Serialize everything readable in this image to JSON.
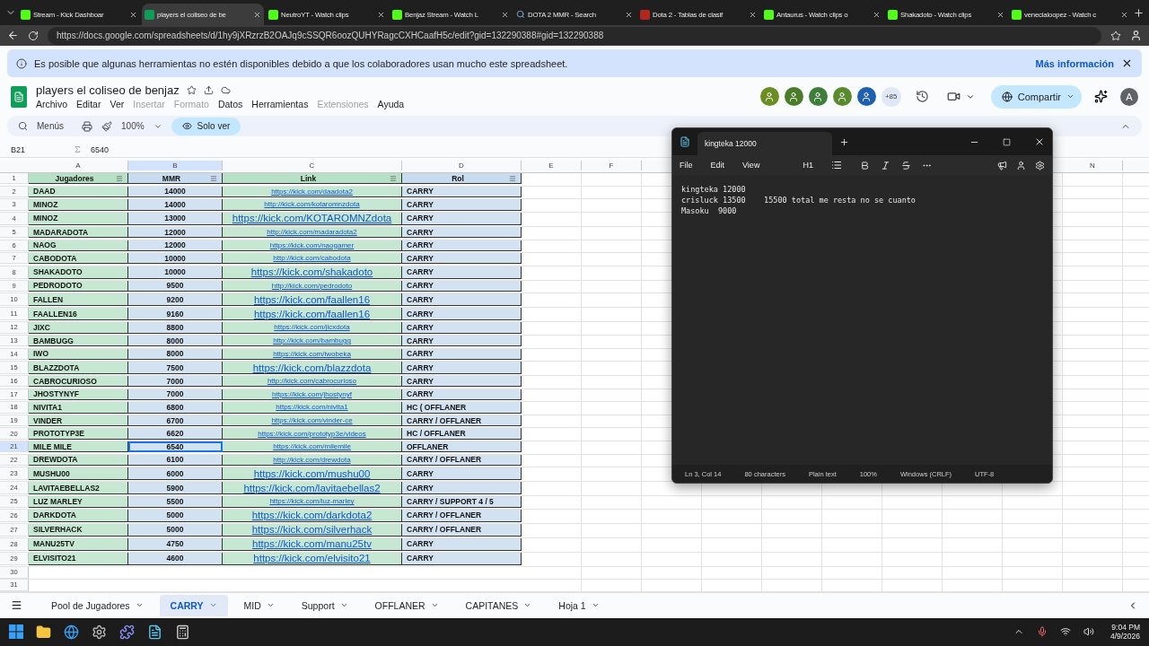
{
  "browser": {
    "tabs": [
      {
        "title": "Stream - Kick Dashboar",
        "kind": "kick",
        "selected": false
      },
      {
        "title": "players el coliseo de be",
        "kind": "sheets",
        "selected": true
      },
      {
        "title": "NeutroYT - Watch clips",
        "kind": "kick",
        "selected": false
      },
      {
        "title": "Benjaz Stream - Watch L",
        "kind": "kick",
        "selected": false
      },
      {
        "title": "DOTA 2 MMR - Search",
        "kind": "search",
        "selected": false
      },
      {
        "title": "Dota 2 - Tablas de clasif",
        "kind": "dota",
        "selected": false
      },
      {
        "title": "Antaurus - Watch clips o",
        "kind": "kick",
        "selected": false
      },
      {
        "title": "Shakadoto - Watch clips",
        "kind": "kick",
        "selected": false
      },
      {
        "title": "venecialoopez - Watch c",
        "kind": "kick",
        "selected": false
      }
    ],
    "url": "https://docs.google.com/spreadsheets/d/1hy9jXRzrzB2OAJq9cSSQR6oozQUHYRagcCXHCaafH5c/edit?gid=132290388#gid=132290388"
  },
  "banner": {
    "text": "Es posible que algunas herramientas no estén disponibles debido a que los colaboradores usan mucho este spreadsheet.",
    "link": "Más información"
  },
  "doc": {
    "title": "players el coliseo de benjaz",
    "menus": [
      {
        "label": "Archivo",
        "disabled": false
      },
      {
        "label": "Editar",
        "disabled": false
      },
      {
        "label": "Ver",
        "disabled": false
      },
      {
        "label": "Insertar",
        "disabled": true
      },
      {
        "label": "Formato",
        "disabled": true
      },
      {
        "label": "Datos",
        "disabled": false
      },
      {
        "label": "Herramientas",
        "disabled": false
      },
      {
        "label": "Extensiones",
        "disabled": true
      },
      {
        "label": "Ayuda",
        "disabled": false
      }
    ],
    "avatars": [
      {
        "color": "#6b8e23"
      },
      {
        "color": "#4a7c2a"
      },
      {
        "color": "#3f7d3a"
      },
      {
        "color": "#5a8a2e"
      },
      {
        "color": "#1f5fb0"
      }
    ],
    "more_count": "+85",
    "share": "Compartir",
    "account": "A"
  },
  "toolbar": {
    "menus": "Menús",
    "zoom": "100%",
    "mode": "Solo ver"
  },
  "formula": {
    "cell": "B21",
    "value": "6540"
  },
  "grid": {
    "columns": [
      "A",
      "B",
      "C",
      "D",
      "E",
      "F"
    ],
    "far_column": "N",
    "header": {
      "number": "1",
      "cells": [
        "Jugadores",
        "MMR",
        "Link",
        "Rol"
      ]
    },
    "rows": [
      {
        "number": "2",
        "player": "DAAD",
        "mmr": "14000",
        "link": "https://kick.com/daadota2",
        "kind": "small",
        "rol": "CARRY",
        "selected": false
      },
      {
        "number": "3",
        "player": "MINOZ",
        "mmr": "14000",
        "link": "http://kick.com/kotaromnzdota",
        "kind": "small",
        "rol": "CARRY",
        "selected": false
      },
      {
        "number": "4",
        "player": "MINOZ",
        "mmr": "13000",
        "link": "https://kick.com/KOTAROMNZdota",
        "kind": "large",
        "rol": "CARRY",
        "selected": false
      },
      {
        "number": "5",
        "player": "MADARADOTA",
        "mmr": "12000",
        "link": "http://kick.com/madaradota2",
        "kind": "small",
        "rol": "CARRY",
        "selected": false
      },
      {
        "number": "6",
        "player": "NAOG",
        "mmr": "12000",
        "link": "https://kick.com/naogamer",
        "kind": "small",
        "rol": "CARRY",
        "selected": false
      },
      {
        "number": "7",
        "player": "CABODOTA",
        "mmr": "10000",
        "link": "http://kick.com/cabodota",
        "kind": "small",
        "rol": "CARRY",
        "selected": false
      },
      {
        "number": "8",
        "player": "SHAKADOTO",
        "mmr": "10000",
        "link": "https://kick.com/shakadoto",
        "kind": "large",
        "rol": "CARRY",
        "selected": false
      },
      {
        "number": "9",
        "player": "PEDRODOTO",
        "mmr": "9500",
        "link": "http://kick.com/pedrodoto",
        "kind": "small",
        "rol": "CARRY",
        "selected": false
      },
      {
        "number": "10",
        "player": "FALLEN",
        "mmr": "9200",
        "link": "https://kick.com/faallen16",
        "kind": "large",
        "rol": "CARRY",
        "selected": false
      },
      {
        "number": "11",
        "player": "FAALLEN16",
        "mmr": "9160",
        "link": "https://kick.com/faallen16",
        "kind": "large",
        "rol": "CARRY",
        "selected": false
      },
      {
        "number": "12",
        "player": "JIXC",
        "mmr": "8800",
        "link": "https://kick.com/jicxdota",
        "kind": "small",
        "rol": "CARRY",
        "selected": false
      },
      {
        "number": "13",
        "player": "BAMBUGG",
        "mmr": "8000",
        "link": "http://kick.com/bambugg",
        "kind": "small",
        "rol": "CARRY",
        "selected": false
      },
      {
        "number": "14",
        "player": "IWO",
        "mmr": "8000",
        "link": "https://kick.com/iwobeka",
        "kind": "small",
        "rol": "CARRY",
        "selected": false
      },
      {
        "number": "15",
        "player": "BLAZZDOTA",
        "mmr": "7500",
        "link": "https://kick.com/blazzdota",
        "kind": "large",
        "rol": "CARRY",
        "selected": false
      },
      {
        "number": "16",
        "player": "CABROCURIOSO",
        "mmr": "7000",
        "link": "http://kick.com/cabrocurioso",
        "kind": "small",
        "rol": "CARRY",
        "selected": false
      },
      {
        "number": "17",
        "player": "JHOSTYNYF",
        "mmr": "7000",
        "link": "https://kick.com/jhostynyf",
        "kind": "small",
        "rol": "CARRY",
        "selected": false
      },
      {
        "number": "18",
        "player": "NIVITA1",
        "mmr": "6800",
        "link": "https://kick.com/nivita1",
        "kind": "small",
        "rol": "HC ( OFFLANER",
        "selected": false
      },
      {
        "number": "19",
        "player": "VINDER",
        "mmr": "6700",
        "link": "https://kick.com/vinder-ce",
        "kind": "small",
        "rol": "CARRY / OFFLANER",
        "selected": false
      },
      {
        "number": "20",
        "player": "PROTOTYP3E",
        "mmr": "6620",
        "link": "https://kick.com/prototyp3e/videos",
        "kind": "small",
        "rol": "HC / OFFLANER",
        "selected": false
      },
      {
        "number": "21",
        "player": "MILE MILE",
        "mmr": "6540",
        "link": "https://kick.com/milemile",
        "kind": "small",
        "rol": "OFFLANER",
        "selected": true
      },
      {
        "number": "22",
        "player": "DREWDOTA",
        "mmr": "6100",
        "link": "http://kick.com/drewdota",
        "kind": "small",
        "rol": "CARRY / OFFLANER",
        "selected": false
      },
      {
        "number": "23",
        "player": "MUSHU00",
        "mmr": "6000",
        "link": "https://kick.com/mushu00",
        "kind": "large",
        "rol": "CARRY",
        "selected": false
      },
      {
        "number": "24",
        "player": "LAVITAEBELLAS2",
        "mmr": "5900",
        "link": "https://kick.com/lavitaebellas2",
        "kind": "large",
        "rol": "CARRY",
        "selected": false
      },
      {
        "number": "25",
        "player": "LUZ MARLEY",
        "mmr": "5500",
        "link": "https://kick.com/luz-marley",
        "kind": "small",
        "rol": "CARRY / SUPPORT 4 / 5",
        "selected": false
      },
      {
        "number": "26",
        "player": "DARKDOTA",
        "mmr": "5000",
        "link": "https://kick.com/darkdota2",
        "kind": "large",
        "rol": "CARRY / OFFLANER",
        "selected": false
      },
      {
        "number": "27",
        "player": "SILVERHACK",
        "mmr": "5000",
        "link": "https://kick.com/silverhack",
        "kind": "large",
        "rol": "CARRY / OFFLANER",
        "selected": false
      },
      {
        "number": "28",
        "player": "MANU25TV",
        "mmr": "4750",
        "link": "https://kick.com/manu25tv",
        "kind": "large",
        "rol": "CARRY",
        "selected": false
      },
      {
        "number": "29",
        "player": "ELVISITO21",
        "mmr": "4600",
        "link": "https://kick.com/elvisito21",
        "kind": "large",
        "rol": "CARRY",
        "selected": false
      }
    ],
    "empty_rows": [
      "30",
      "31"
    ]
  },
  "notepad": {
    "tab": "kingteka 12000",
    "menus": [
      "File",
      "Edit",
      "View"
    ],
    "heading": "H1",
    "lines": [
      "kingteka 12000",
      "crisluck 13500    15500 total me resta no se cuanto",
      "Masoku  9000 "
    ],
    "status": [
      "Ln 3, Col 14",
      "80 characters",
      "Plain text",
      "100%",
      "Windows (CRLF)",
      "UTF-8"
    ]
  },
  "sheet_tabs": [
    {
      "label": "Pool de Jugadores",
      "selected": false
    },
    {
      "label": "CARRY",
      "selected": true
    },
    {
      "label": "MID",
      "selected": false
    },
    {
      "label": "Support",
      "selected": false
    },
    {
      "label": "OFFLANER",
      "selected": false
    },
    {
      "label": "CAPITANES",
      "selected": false
    },
    {
      "label": "Hoja 1",
      "selected": false
    }
  ],
  "taskbar": {
    "time": "9:04 PM",
    "date": "4/9/2026"
  }
}
